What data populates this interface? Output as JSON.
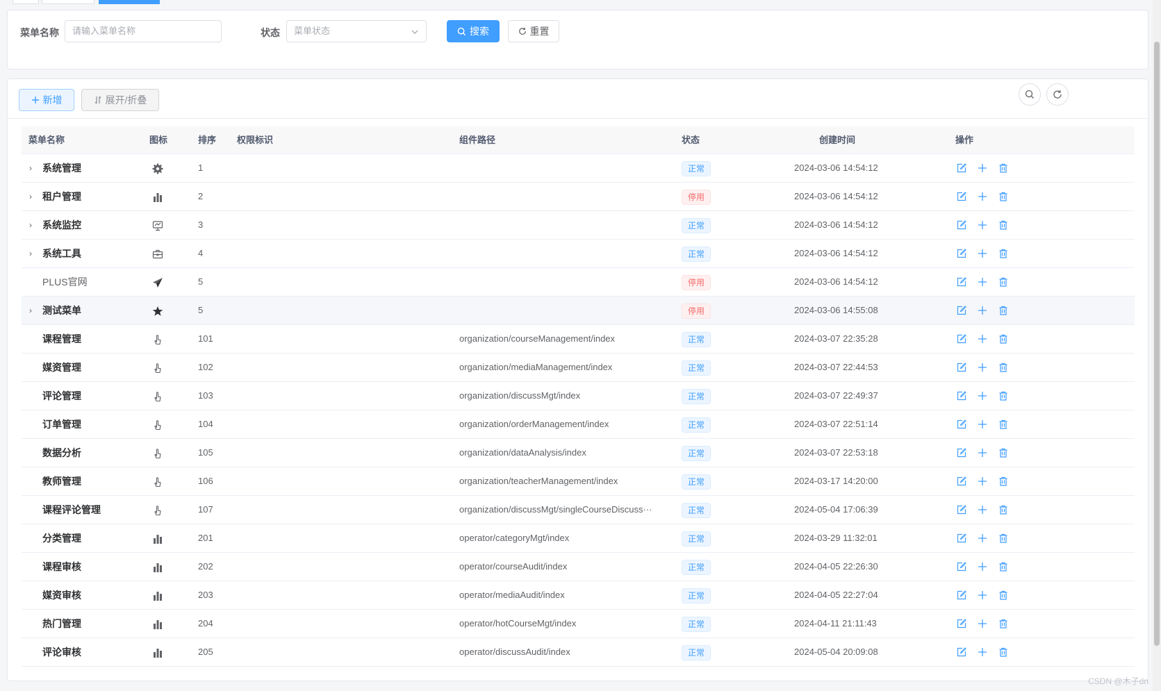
{
  "search": {
    "menu_name_label": "菜单名称",
    "menu_name_placeholder": "请输入菜单名称",
    "status_label": "状态",
    "status_placeholder": "菜单状态",
    "search_button": "搜索",
    "reset_button": "重置"
  },
  "toolbar": {
    "add_button": "新增",
    "toggle_button": "展开/折叠"
  },
  "table": {
    "headers": [
      "菜单名称",
      "图标",
      "排序",
      "权限标识",
      "组件路径",
      "状态",
      "创建时间",
      "操作"
    ],
    "rows": [
      {
        "name": "系统管理",
        "expandable": true,
        "icon": "gear-icon",
        "order": "1",
        "path": "",
        "status": "正常",
        "created": "2024-03-06 14:54:12"
      },
      {
        "name": "租户管理",
        "expandable": true,
        "icon": "bar-chart-icon",
        "order": "2",
        "path": "",
        "status": "停用",
        "created": "2024-03-06 14:54:12"
      },
      {
        "name": "系统监控",
        "expandable": true,
        "icon": "monitor-icon",
        "order": "3",
        "path": "",
        "status": "正常",
        "created": "2024-03-06 14:54:12"
      },
      {
        "name": "系统工具",
        "expandable": true,
        "icon": "toolbox-icon",
        "order": "4",
        "path": "",
        "status": "正常",
        "created": "2024-03-06 14:54:12"
      },
      {
        "name": "PLUS官网",
        "expandable": false,
        "icon": "paper-plane-icon",
        "order": "5",
        "path": "",
        "status": "停用",
        "created": "2024-03-06 14:54:12"
      },
      {
        "name": "测试菜单",
        "expandable": true,
        "icon": "star-icon",
        "order": "5",
        "path": "",
        "status": "停用",
        "created": "2024-03-06 14:55:08"
      },
      {
        "name": "课程管理",
        "expandable": false,
        "icon": "hand-pointer-icon",
        "order": "101",
        "path": "organization/courseManagement/index",
        "status": "正常",
        "created": "2024-03-07 22:35:28"
      },
      {
        "name": "媒资管理",
        "expandable": false,
        "icon": "hand-pointer-icon",
        "order": "102",
        "path": "organization/mediaManagement/index",
        "status": "正常",
        "created": "2024-03-07 22:44:53"
      },
      {
        "name": "评论管理",
        "expandable": false,
        "icon": "hand-pointer-icon",
        "order": "103",
        "path": "organization/discussMgt/index",
        "status": "正常",
        "created": "2024-03-07 22:49:37"
      },
      {
        "name": "订单管理",
        "expandable": false,
        "icon": "hand-pointer-icon",
        "order": "104",
        "path": "organization/orderManagement/index",
        "status": "正常",
        "created": "2024-03-07 22:51:14"
      },
      {
        "name": "数据分析",
        "expandable": false,
        "icon": "hand-pointer-icon",
        "order": "105",
        "path": "organization/dataAnalysis/index",
        "status": "正常",
        "created": "2024-03-07 22:53:18"
      },
      {
        "name": "教师管理",
        "expandable": false,
        "icon": "hand-pointer-icon",
        "order": "106",
        "path": "organization/teacherManagement/index",
        "status": "正常",
        "created": "2024-03-17 14:20:00"
      },
      {
        "name": "课程评论管理",
        "expandable": false,
        "icon": "hand-pointer-icon",
        "order": "107",
        "path": "organization/discussMgt/singleCourseDiscuss···",
        "status": "正常",
        "created": "2024-05-04 17:06:39"
      },
      {
        "name": "分类管理",
        "expandable": false,
        "icon": "bar-chart-icon",
        "order": "201",
        "path": "operator/categoryMgt/index",
        "status": "正常",
        "created": "2024-03-29 11:32:01"
      },
      {
        "name": "课程审核",
        "expandable": false,
        "icon": "bar-chart-icon",
        "order": "202",
        "path": "operator/courseAudit/index",
        "status": "正常",
        "created": "2024-04-05 22:26:30"
      },
      {
        "name": "媒资审核",
        "expandable": false,
        "icon": "bar-chart-icon",
        "order": "203",
        "path": "operator/mediaAudit/index",
        "status": "正常",
        "created": "2024-04-05 22:27:04"
      },
      {
        "name": "热门管理",
        "expandable": false,
        "icon": "bar-chart-icon",
        "order": "204",
        "path": "operator/hotCourseMgt/index",
        "status": "正常",
        "created": "2024-04-11 21:11:43"
      },
      {
        "name": "评论审核",
        "expandable": false,
        "icon": "bar-chart-icon",
        "order": "205",
        "path": "operator/discussAudit/index",
        "status": "正常",
        "created": "2024-05-04 20:09:08"
      }
    ]
  },
  "watermark": "CSDN @木子dn",
  "colors": {
    "primary": "#409eff",
    "danger": "#f56c6c"
  }
}
